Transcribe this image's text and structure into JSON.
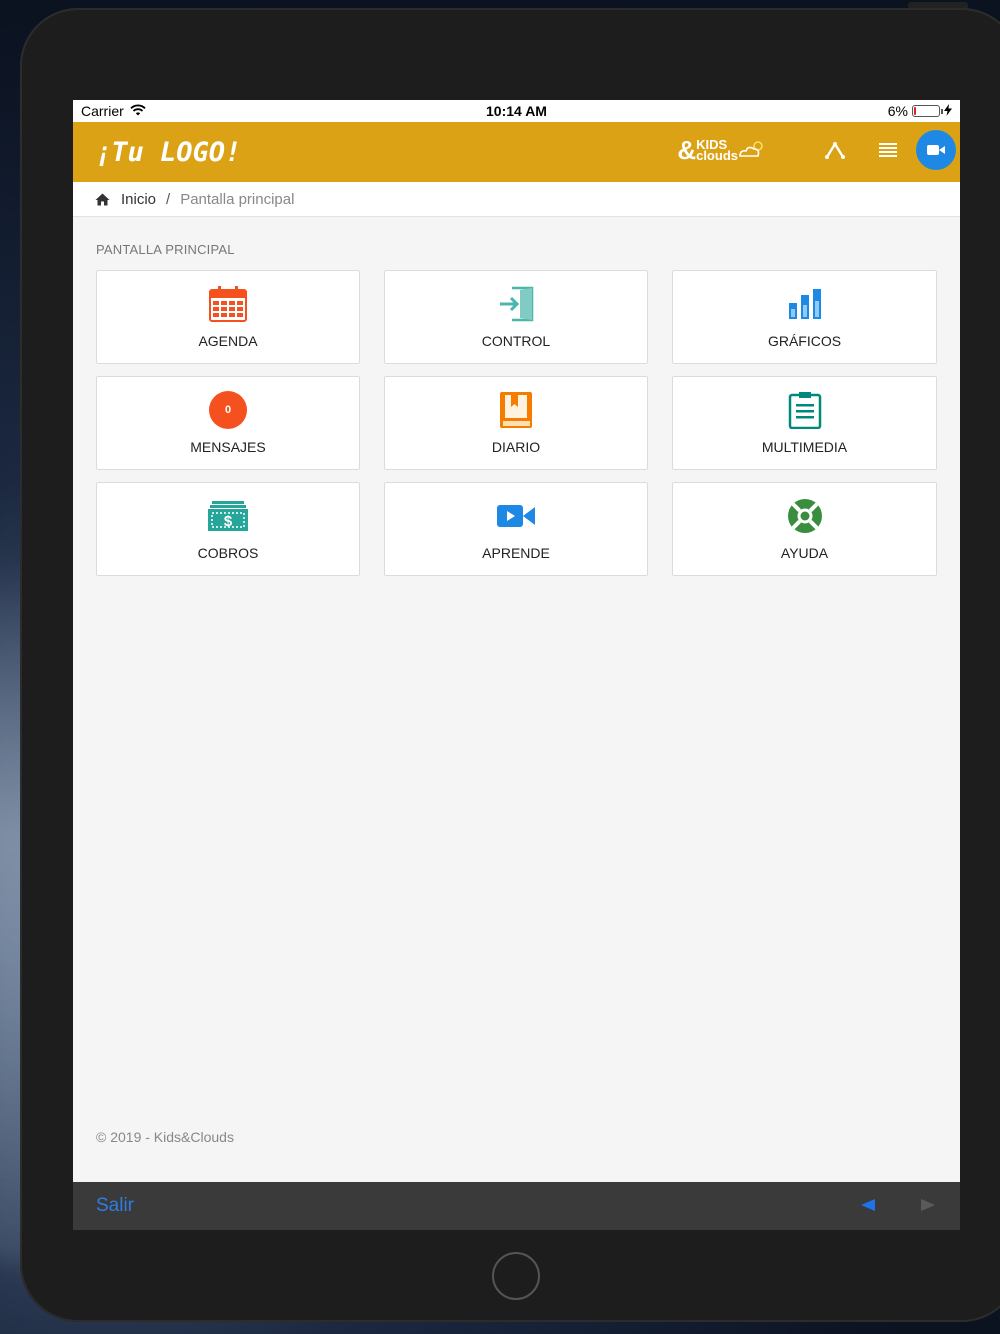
{
  "status_bar": {
    "carrier": "Carrier",
    "time": "10:14 AM",
    "battery_percent": "6%",
    "battery_level": 0.06
  },
  "header": {
    "logo_text": "¡Tu LOGO!",
    "brand_amp": "&",
    "brand_line1": "KIDS",
    "brand_line2": "clouds",
    "accent_color": "#dba215"
  },
  "breadcrumb": {
    "home": "Inicio",
    "separator": "/",
    "current": "Pantalla principal"
  },
  "section_title": "PANTALLA PRINCIPAL",
  "tiles": [
    {
      "label": "AGENDA",
      "icon": "calendar-icon",
      "color": "#f4511e"
    },
    {
      "label": "CONTROL",
      "icon": "door-enter-icon",
      "color": "#4db6ac"
    },
    {
      "label": "GRÁFICOS",
      "icon": "bar-chart-icon",
      "color": "#1e88e5"
    },
    {
      "label": "MENSAJES",
      "icon": "message-badge-icon",
      "color": "#f4511e",
      "badge": "0"
    },
    {
      "label": "DIARIO",
      "icon": "book-bookmark-icon",
      "color": "#f57c00"
    },
    {
      "label": "MULTIMEDIA",
      "icon": "clipboard-icon",
      "color": "#00897b"
    },
    {
      "label": "COBROS",
      "icon": "money-icon",
      "color": "#26a69a"
    },
    {
      "label": "APRENDE",
      "icon": "video-camera-icon",
      "color": "#1e88e5"
    },
    {
      "label": "AYUDA",
      "icon": "lifebuoy-icon",
      "color": "#388e3c"
    }
  ],
  "footer": "© 2019 - Kids&Clouds",
  "toolbar": {
    "exit_label": "Salir"
  }
}
